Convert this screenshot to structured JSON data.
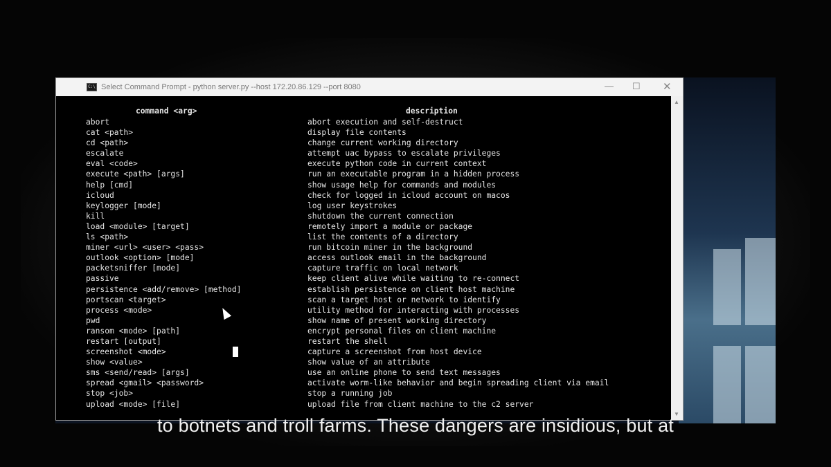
{
  "window": {
    "title": "Select Command Prompt - python  server.py --host 172.20.86.129 --port 8080",
    "icon_text": "C:\\",
    "minimize": "—",
    "maximize": "☐",
    "close": "✕"
  },
  "console": {
    "header_command": "command <arg>",
    "header_description": "description",
    "rows": [
      {
        "cmd": "abort",
        "desc": "abort execution and self-destruct"
      },
      {
        "cmd": "cat <path>",
        "desc": "display file contents"
      },
      {
        "cmd": "cd <path>",
        "desc": "change current working directory"
      },
      {
        "cmd": "escalate",
        "desc": "attempt uac bypass to escalate privileges"
      },
      {
        "cmd": "eval <code>",
        "desc": "execute python code in current context"
      },
      {
        "cmd": "execute <path> [args]",
        "desc": "run an executable program in a hidden process"
      },
      {
        "cmd": "help [cmd]",
        "desc": "show usage help for commands and modules"
      },
      {
        "cmd": "icloud",
        "desc": "check for logged in icloud account on macos"
      },
      {
        "cmd": "keylogger [mode]",
        "desc": "log user keystrokes"
      },
      {
        "cmd": "kill",
        "desc": "shutdown the current connection"
      },
      {
        "cmd": "load <module> [target]",
        "desc": "remotely import a module or package"
      },
      {
        "cmd": "ls <path>",
        "desc": "list the contents of a directory"
      },
      {
        "cmd": "miner <url> <user> <pass>",
        "desc": "run bitcoin miner in the background"
      },
      {
        "cmd": "outlook <option> [mode]",
        "desc": "access outlook email in the background"
      },
      {
        "cmd": "packetsniffer [mode]",
        "desc": "capture traffic on local network"
      },
      {
        "cmd": "passive",
        "desc": "keep client alive while waiting to re-connect"
      },
      {
        "cmd": "persistence <add/remove> [method]",
        "desc": "establish persistence on client host machine"
      },
      {
        "cmd": "portscan <target>",
        "desc": "scan a target host or network to identify"
      },
      {
        "cmd": "process <mode>",
        "desc": "utility method for interacting with processes"
      },
      {
        "cmd": "pwd",
        "desc": "show name of present working directory"
      },
      {
        "cmd": "ransom <mode> [path]",
        "desc": "encrypt personal files on client machine"
      },
      {
        "cmd": "restart [output]",
        "desc": "restart the shell"
      },
      {
        "cmd": "screenshot <mode>",
        "desc": "capture a screenshot from host device"
      },
      {
        "cmd": "show <value>",
        "desc": "show value of an attribute"
      },
      {
        "cmd": "sms <send/read> [args]",
        "desc": "use an online phone to send text messages"
      },
      {
        "cmd": "spread <gmail> <password>",
        "desc": "activate worm-like behavior and begin spreading client via email"
      },
      {
        "cmd": "stop <job>",
        "desc": "stop a running job"
      },
      {
        "cmd": "upload <mode> [file]",
        "desc": "upload file from client machine to the c2 server"
      }
    ]
  },
  "scrollbar": {
    "up": "▲",
    "down": "▼"
  },
  "caption": "to botnets and troll farms. These dangers are insidious, but at"
}
